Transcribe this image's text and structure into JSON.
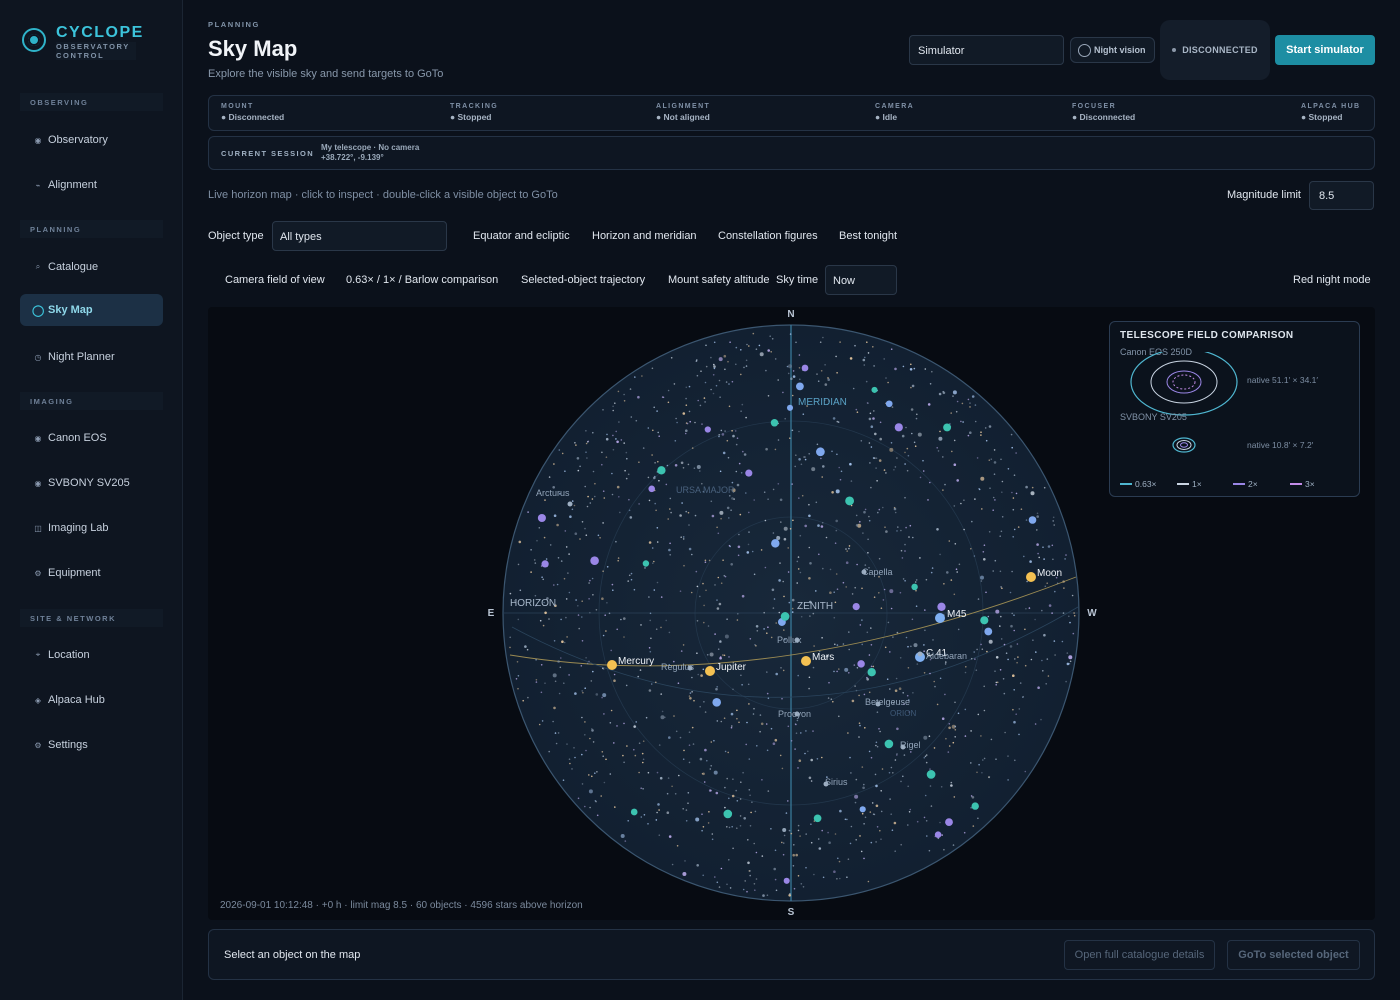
{
  "brand": {
    "title": "CYCLOPE",
    "subtitle": "OBSERVATORY CONTROL"
  },
  "sidebar": {
    "groups": [
      {
        "label": "OBSERVING",
        "items": [
          {
            "label": "Observatory",
            "icon": "observatory-icon"
          },
          {
            "label": "Alignment",
            "icon": "alignment-icon"
          }
        ]
      },
      {
        "label": "PLANNING",
        "items": [
          {
            "label": "Catalogue",
            "icon": "catalogue-icon"
          },
          {
            "label": "Sky Map",
            "icon": "sky-map-icon",
            "active": true
          },
          {
            "label": "Night Planner",
            "icon": "clock-icon"
          }
        ]
      },
      {
        "label": "IMAGING",
        "items": [
          {
            "label": "Canon EOS",
            "icon": "camera-icon"
          },
          {
            "label": "SVBONY SV205",
            "icon": "camera-icon"
          },
          {
            "label": "Imaging Lab",
            "icon": "lab-icon"
          },
          {
            "label": "Equipment",
            "icon": "equipment-icon"
          }
        ]
      },
      {
        "label": "SITE & NETWORK",
        "items": [
          {
            "label": "Location",
            "icon": "location-icon"
          },
          {
            "label": "Alpaca Hub",
            "icon": "hub-icon"
          },
          {
            "label": "Settings",
            "icon": "gear-icon"
          }
        ]
      }
    ]
  },
  "header": {
    "eyebrow": "PLANNING",
    "title": "Sky Map",
    "subtitle": "Explore the visible sky and send targets to GoTo",
    "driver": "Simulator",
    "night_vision": "Night vision",
    "connection": "DISCONNECTED",
    "start_button": "Start simulator"
  },
  "status": [
    {
      "label": "MOUNT",
      "value": "Disconnected"
    },
    {
      "label": "TRACKING",
      "value": "Stopped"
    },
    {
      "label": "ALIGNMENT",
      "value": "Not aligned"
    },
    {
      "label": "CAMERA",
      "value": "Idle"
    },
    {
      "label": "FOCUSER",
      "value": "Disconnected"
    },
    {
      "label": "ALPACA HUB",
      "value": "Stopped"
    }
  ],
  "session": {
    "label": "CURRENT SESSION",
    "line1": "My telescope · No camera",
    "line2": "+38.722°, -9.139°"
  },
  "controls": {
    "hint": "Live horizon map · click to inspect · double-click a visible object to GoTo",
    "magnitude_label": "Magnitude limit",
    "magnitude_value": "8.5",
    "object_type_label": "Object type",
    "object_type_value": "All types",
    "toggles_row1": [
      "Equator and ecliptic",
      "Horizon and meridian",
      "Constellation figures",
      "Best tonight"
    ],
    "toggles_row2": [
      "Camera field of view",
      "0.63× / 1× / Barlow comparison",
      "Selected-object trajectory",
      "Mount safety altitude"
    ],
    "sky_time_label": "Sky time",
    "sky_time_value": "Now",
    "red_night_mode": "Red night mode"
  },
  "map": {
    "cardinals": {
      "n": "N",
      "s": "S",
      "e": "E",
      "w": "W"
    },
    "region_labels": {
      "meridian": "MERIDIAN",
      "zenith": "ZENITH",
      "horizon": "HORIZON",
      "ursa": "URSA MAJOR",
      "orion": "ORION"
    },
    "objects": [
      {
        "name": "Moon",
        "kind": "moon"
      },
      {
        "name": "M45",
        "kind": "dso"
      },
      {
        "name": "C 41",
        "kind": "dso"
      },
      {
        "name": "Mars",
        "kind": "planet"
      },
      {
        "name": "Jupiter",
        "kind": "planet"
      },
      {
        "name": "Mercury",
        "kind": "planet"
      },
      {
        "name": "Arcturus",
        "kind": "star"
      },
      {
        "name": "Capella",
        "kind": "star"
      },
      {
        "name": "Pollux",
        "kind": "star"
      },
      {
        "name": "Regulus",
        "kind": "star"
      },
      {
        "name": "Aldebaran",
        "kind": "star"
      },
      {
        "name": "Procyon",
        "kind": "star"
      },
      {
        "name": "Betelgeuse",
        "kind": "star"
      },
      {
        "name": "Rigel",
        "kind": "star"
      },
      {
        "name": "Sirius",
        "kind": "star"
      }
    ],
    "footer": "2026-09-01 10:12:48 · +0 h · limit mag 8.5 · 60 objects · 4596 stars above horizon"
  },
  "fov": {
    "title": "TELESCOPE FIELD COMPARISON",
    "cameras": [
      {
        "name": "Canon EOS 250D",
        "native": "native 51.1′ × 34.1′"
      },
      {
        "name": "SVBONY SV205",
        "native": "native 10.8′ × 7.2′"
      }
    ],
    "legend": [
      {
        "label": "0.63×",
        "color": "#4fb6d0"
      },
      {
        "label": "1×",
        "color": "#c9d4e2"
      },
      {
        "label": "2×",
        "color": "#9a86e6"
      },
      {
        "label": "3×",
        "color": "#c38ce8"
      }
    ]
  },
  "bottom": {
    "selection": "Select an object on the map",
    "details_button": "Open full catalogue details",
    "goto_button": "GoTo selected object"
  }
}
